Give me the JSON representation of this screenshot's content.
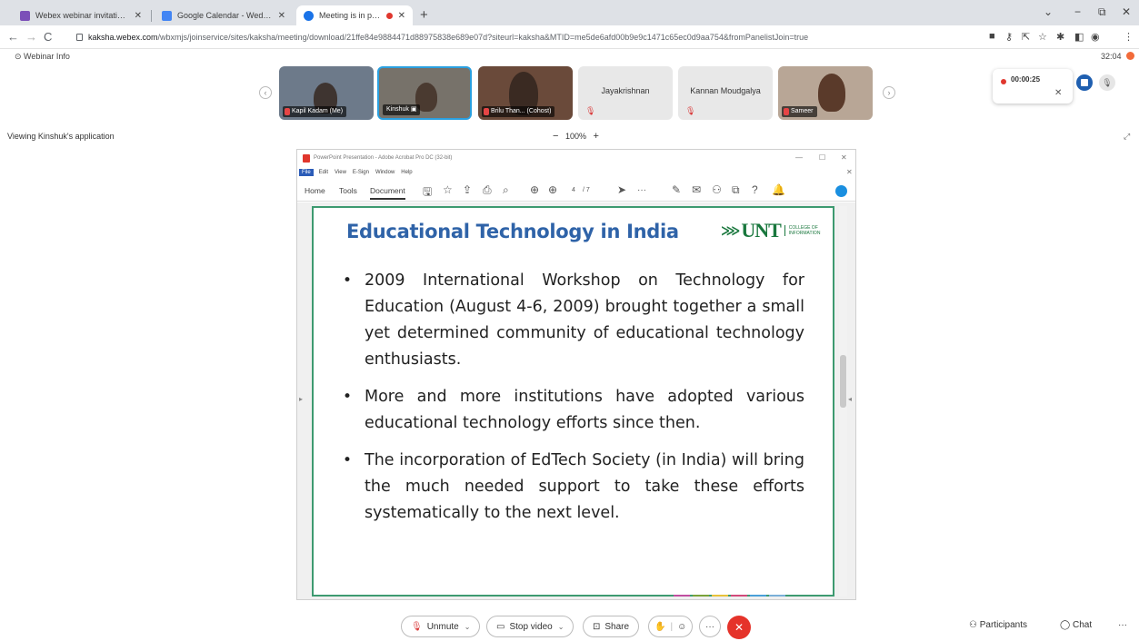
{
  "browser": {
    "tabs": [
      {
        "title": "Webex webinar invitation: EdTec",
        "favicon_color": "#7b4fb8"
      },
      {
        "title": "Google Calendar - Wednesday, A",
        "favicon_color": "#4285f4"
      },
      {
        "title": "Meeting is in progress...",
        "favicon_color": "#1a73e8"
      }
    ],
    "new_tab": "+",
    "window_controls": {
      "minimize": "−",
      "restore": "⧉",
      "close": "✕",
      "dropdown": "⌄"
    },
    "url_host": "kaksha.webex.com",
    "url_path": "/wbxmjs/joinservice/sites/kaksha/meeting/download/21ffe84e9884471d88975838e689e07d?siteurl=kaksha&MTID=me5de6afd00b9e9c1471c65ec0d9aa754&fromPanelistJoin=true"
  },
  "meeting": {
    "webinar_info": "⊙ Webinar Info",
    "elapsed": "32:04",
    "recording_time": "00:00:25",
    "viewing_label": "Viewing Kinshuk's application",
    "zoom_minus": "−",
    "zoom_level": "100%",
    "zoom_plus": "+",
    "participants": [
      {
        "name": "Kapil Kadam (Me)",
        "type": "video"
      },
      {
        "name": "Kinshuk",
        "type": "video"
      },
      {
        "name": "Brilu Than... (Cohost)",
        "type": "video"
      },
      {
        "name": "Jayakrishnan",
        "type": "avatar"
      },
      {
        "name": "Kannan Moudgalya",
        "type": "avatar"
      },
      {
        "name": "Sameer",
        "type": "video"
      }
    ]
  },
  "acrobat": {
    "window_title": "PowerPoint Presentation - Adobe Acrobat Pro DC (32-bit)",
    "menu": [
      "File",
      "Edit",
      "View",
      "E-Sign",
      "Window",
      "Help"
    ],
    "toolbar_tabs": [
      "Home",
      "Tools",
      "Document"
    ],
    "page_current": "4",
    "page_total": "/ 7"
  },
  "slide": {
    "title": "Educational Technology in India",
    "logo_text": "UNT",
    "logo_subtext_1": "COLLEGE OF",
    "logo_subtext_2": "INFORMATION",
    "bullets": [
      "2009 International Workshop on Technology for Education (August 4-6, 2009) brought together a small yet determined community of educational technology enthusiasts.",
      "More and more institutions have adopted various educational technology efforts since then.",
      "The incorporation of EdTech Society (in India) will bring the much needed support to take these efforts systematically to the next level."
    ]
  },
  "controls": {
    "unmute": "Unmute",
    "stop_video": "Stop video",
    "share": "Share",
    "participants": "Participants",
    "chat": "Chat",
    "more": "···"
  },
  "colors": {
    "accent_blue": "#2aa0e0",
    "end_red": "#e5332a",
    "slide_title": "#2f63a8",
    "unt_green": "#19773d"
  }
}
